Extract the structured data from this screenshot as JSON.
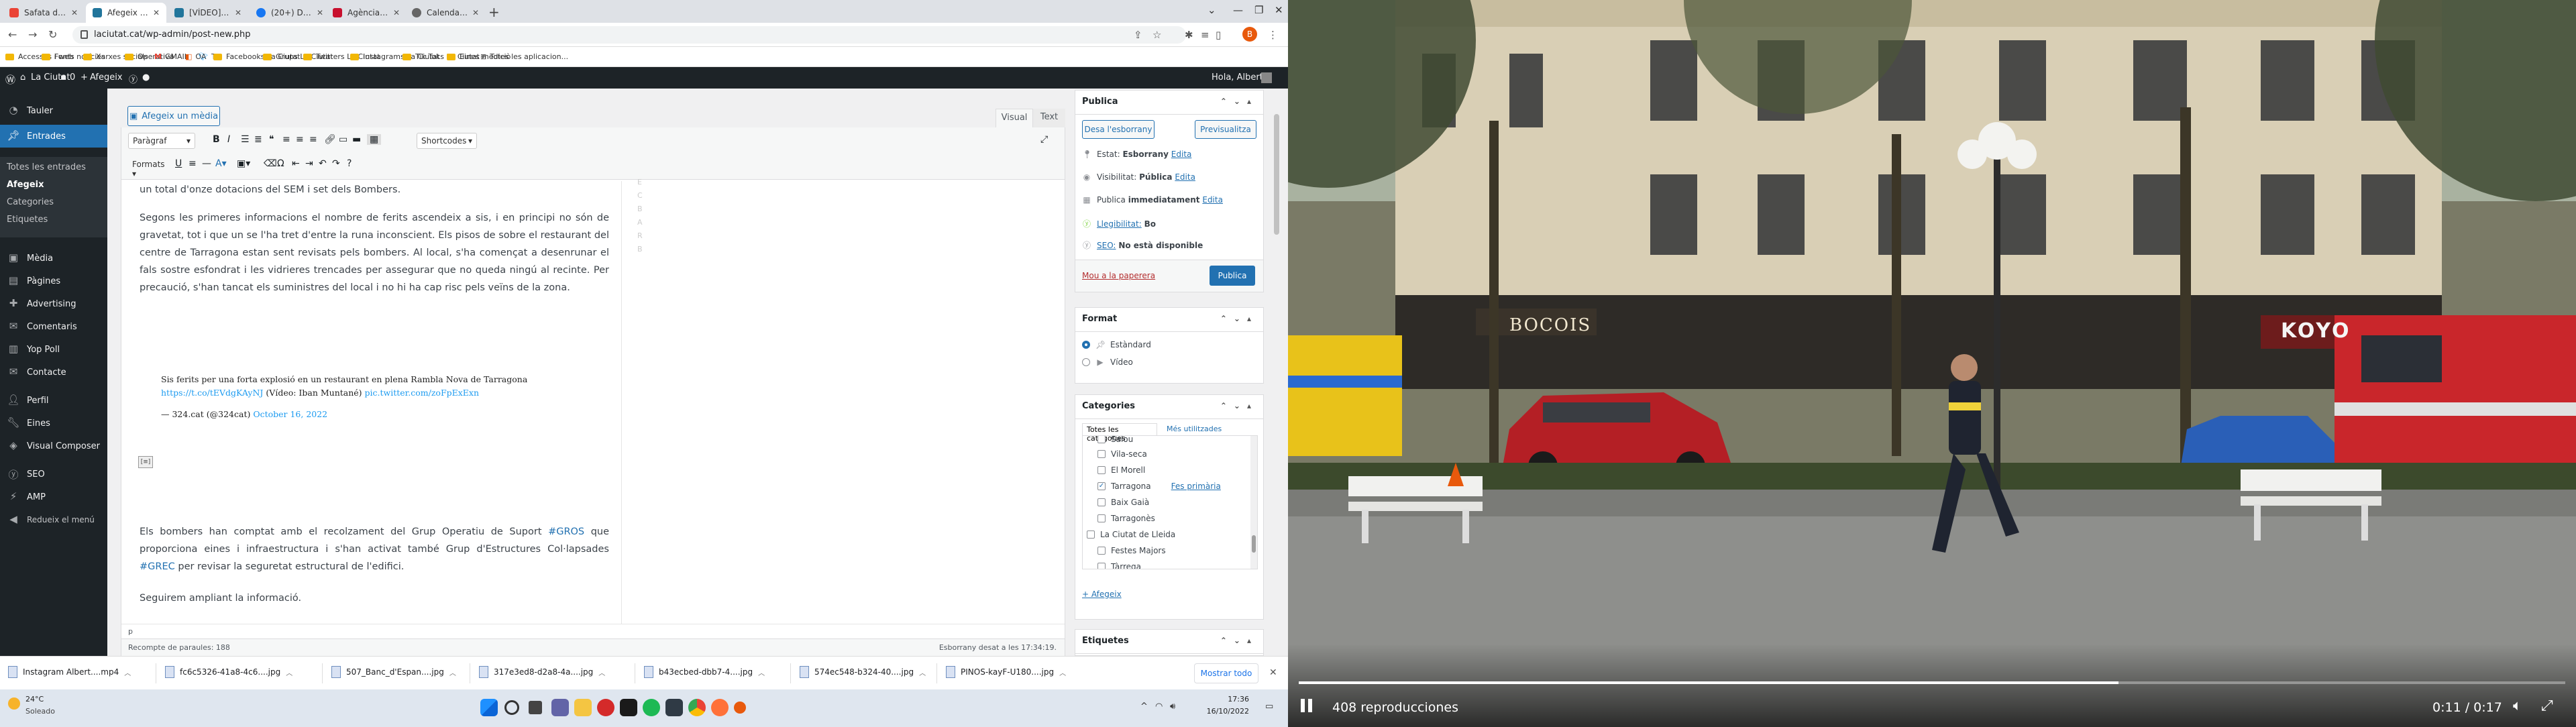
{
  "browser": {
    "tabs": [
      {
        "title": "Safata d'entrada (7) - laciutat.cat",
        "color": "#ea4335"
      },
      {
        "title": "Afegeix una entrada nova ‹ La Ciutat",
        "color": "#21759b",
        "active": true
      },
      {
        "title": "[VÍDEO] Una explosió en un restaurant",
        "color": "#21759b"
      },
      {
        "title": "(20+) Diari La Ciutat de Girona | Facebook",
        "color": "#1877f2"
      },
      {
        "title": "Agència Catalana de Notícies",
        "color": "#c8102e"
      },
      {
        "title": "Calendario",
        "color": "#666666"
      }
    ],
    "new_tab": "+",
    "url": "laciutat.cat/wp-admin/post-new.php",
    "profile_initial": "B",
    "bookmarks": [
      "Accessos i web",
      "Fonts notícies",
      "Xarxes socials",
      "Operativa",
      "GMAIL",
      "OA",
      "TA",
      "Facebooks La Ciutat",
      "Grups La Ciutat",
      "Twitters La Ciutat",
      "Instagrams La Ciutat",
      "Tik Toks La Ciutat",
      "Eines mediciò",
      "Totes les aplicacion..."
    ]
  },
  "wpbar": {
    "site": "La Ciutat",
    "comments": "0",
    "new": "Afegeix",
    "greeting": "Hola, Albert"
  },
  "sidebar": {
    "items": [
      {
        "label": "Tauler",
        "icon": "dashboard-icon"
      },
      {
        "label": "Entrades",
        "icon": "pin-icon",
        "current": true
      },
      {
        "label": "Mèdia",
        "icon": "media-icon"
      },
      {
        "label": "Pàgines",
        "icon": "pages-icon"
      },
      {
        "label": "Advertising",
        "icon": "ads-icon"
      },
      {
        "label": "Comentaris",
        "icon": "comment-icon"
      },
      {
        "label": "Yop Poll",
        "icon": "poll-icon"
      },
      {
        "label": "Contacte",
        "icon": "mail-icon"
      },
      {
        "label": "Perfil",
        "icon": "user-icon"
      },
      {
        "label": "Eines",
        "icon": "wrench-icon"
      },
      {
        "label": "Visual Composer",
        "icon": "composer-icon"
      },
      {
        "label": "SEO",
        "icon": "seo-icon"
      },
      {
        "label": "AMP",
        "icon": "amp-icon"
      },
      {
        "label": "Redueix el menú",
        "icon": "collapse-icon"
      }
    ],
    "submenu": [
      "Totes les entrades",
      "Afegeix",
      "Categories",
      "Etiquetes"
    ]
  },
  "editor": {
    "media_button": "Afegeix un mèdia",
    "tab_visual": "Visual",
    "tab_text": "Text",
    "format_select": "Paràgraf",
    "shortcodes": "Shortcodes",
    "formats_menu": "Formats",
    "paragraphs": [
      "un total d'onze dotacions del SEM i set dels Bombers.",
      "Segons les primeres informacions el nombre de ferits ascendeix a sis, i en principi no són de gravetat, tot i que un se l'ha tret d'entre la runa inconscient. Els pisos de sobre el restaurant del centre de Tarragona estan sent revisats pels bombers. Al local, s'ha començat a desenrunar el fals sostre esfondrat i les vidrieres trencades per assegurar que no queda ningú al recinte. Per precaució, s'han tancat els suministres del local i no hi ha cap risc pels veïns de la zona."
    ],
    "embed": {
      "text": "Sis ferits per una forta explosió en un restaurant en plena Rambla Nova de Tarragona",
      "link1": "https://t.co/tEVdgKAyNJ",
      "credit": "(Vídeo: Iban Muntané)",
      "link2": "pic.twitter.com/zoFpExExn",
      "author": "— 324.cat (@324cat)",
      "date": "October 16, 2022"
    },
    "para3_a": "Els bombers han comptat amb el recolzament del Grup Operatiu de Suport",
    "para3_link1": "#GROS",
    "para3_b": "que proporciona eines i infraestructura i s'han activat també Grup d'Estructures Col·lapsades",
    "para3_link2": "#GREC",
    "para3_c": "per revisar la seguretat estructural de l'edifici.",
    "para4": "Seguirem ampliant la informació.",
    "path": "p",
    "word_count": "Recompte de paraules: 188",
    "draft_saved": "Esborrany desat a les 17:34:19."
  },
  "publish": {
    "title": "Publica",
    "save_draft": "Desa l'esborrany",
    "preview": "Previsualitza",
    "status_label": "Estat:",
    "status_value": "Esborrany",
    "edit": "Edita",
    "visibility_label": "Visibilitat:",
    "visibility_value": "Pública",
    "publish_label": "Publica",
    "publish_value": "immediatament",
    "readability": "Llegibilitat:",
    "readability_value": "Bo",
    "seo": "SEO:",
    "seo_value": "No està disponible",
    "trash": "Mou a la paperera",
    "publish_btn": "Publica"
  },
  "format": {
    "title": "Format",
    "opt1": "Estàndard",
    "opt2": "Vídeo"
  },
  "categories": {
    "title": "Categories",
    "tab_all": "Totes les categories",
    "tab_used": "Més utilitzades",
    "items": [
      {
        "label": "Salou",
        "checked": false,
        "indent": 1
      },
      {
        "label": "Vila-seca",
        "checked": false,
        "indent": 1
      },
      {
        "label": "El Morell",
        "checked": false,
        "indent": 1
      },
      {
        "label": "Tarragona",
        "checked": true,
        "indent": 1
      },
      {
        "label": "Baix Gaià",
        "checked": false,
        "indent": 1
      },
      {
        "label": "Tarragonès",
        "checked": false,
        "indent": 1
      },
      {
        "label": "La Ciutat de Lleida",
        "checked": false,
        "indent": 0
      },
      {
        "label": "Festes Majors",
        "checked": false,
        "indent": 1
      },
      {
        "label": "Tàrrega",
        "checked": false,
        "indent": 1
      }
    ],
    "primary": "Fes primària",
    "add": "+ Afegeix"
  },
  "tags": {
    "title": "Etiquetes"
  },
  "downloads": {
    "items": [
      "Instagram Albert....mp4",
      "fc6c5326-41a8-4c6....jpg",
      "507_Banc_d'Espan....jpg",
      "317e3ed8-d2a8-4a....jpg",
      "b43ecbed-dbb7-4....jpg",
      "574ec548-b324-40....jpg",
      "PINOS-kayF-U180....jpg"
    ],
    "show_all": "Mostrar todo"
  },
  "taskbar": {
    "temp": "24°C",
    "weather": "Soleado",
    "time": "17:36",
    "date": "16/10/2022"
  },
  "video": {
    "views": "408 reproducciones",
    "time": "0:11 / 0:17",
    "progress": 0.647,
    "signs": [
      "BOCOIS",
      "KOYO"
    ]
  }
}
